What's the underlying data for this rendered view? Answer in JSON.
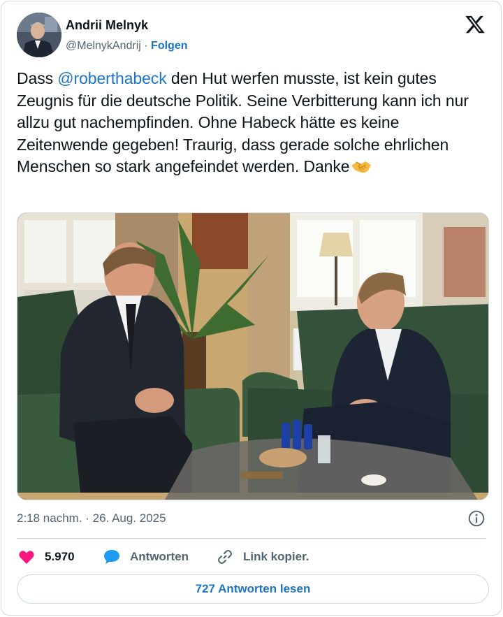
{
  "author": {
    "name": "Andrii Melnyk",
    "handle": "@MelnykAndrij",
    "separator": " · ",
    "follow_label": "Folgen"
  },
  "tweet": {
    "text_before": "Dass ",
    "mention": "@roberthabeck",
    "text_after": " den Hut werfen musste, ist kein gutes Zeugnis für die deutsche Politik. Seine Verbitterung kann ich nur allzu gut nachempfinden. Ohne Habeck hätte es keine Zeitenwende gegeben! Traurig, dass gerade solche ehrlichen Menschen so stark angefeindet werden. Danke",
    "emoji": "handshake-emoji",
    "timestamp": "2:18 nachm. · 26. Aug. 2025"
  },
  "actions": {
    "likes": "5.970",
    "reply_label": "Antworten",
    "copy_link_label": "Link kopier."
  },
  "read_replies_label": "727 Antworten lesen",
  "icons": [
    "x-logo-icon",
    "info-icon",
    "heart-icon",
    "reply-bubble-icon",
    "link-icon"
  ],
  "colors": {
    "accent": "#1d74c4",
    "like": "#f91880",
    "muted": "#536471",
    "border": "#cfd9de"
  }
}
